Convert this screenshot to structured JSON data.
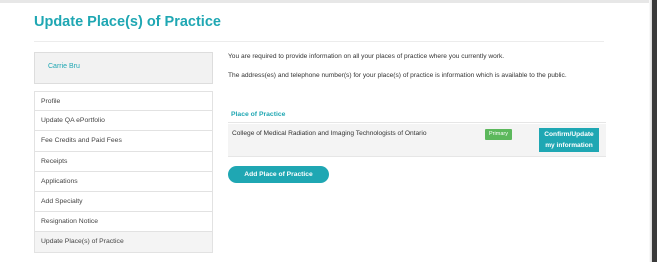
{
  "page": {
    "title": "Update Place(s) of Practice"
  },
  "user": {
    "name": "Carrie Bru"
  },
  "sidebar": {
    "items": [
      {
        "label": "Profile"
      },
      {
        "label": "Update QA ePortfolio"
      },
      {
        "label": "Fee Credits and Paid Fees"
      },
      {
        "label": "Receipts"
      },
      {
        "label": "Applications"
      },
      {
        "label": "Add Specialty"
      },
      {
        "label": "Resignation Notice"
      },
      {
        "label": "Update Place(s) of Practice"
      }
    ]
  },
  "intro": {
    "line1": "You are required to provide information on all your places of practice where you currently work.",
    "line2": "The address(es) and telephone number(s) for your place(s) of practice is information which is available to the public."
  },
  "places_of_practice": {
    "header": "Place of Practice",
    "rows": [
      {
        "name": "College of Medical Radiation and Imaging Technologists of Ontario",
        "badge": "Primary",
        "action_line1": "Confirm/Update",
        "action_line2": "my information"
      }
    ]
  },
  "add_button": {
    "label": "Add Place of Practice"
  },
  "colors": {
    "accent": "#1fa7b3",
    "badge_primary": "#5cb85c"
  }
}
